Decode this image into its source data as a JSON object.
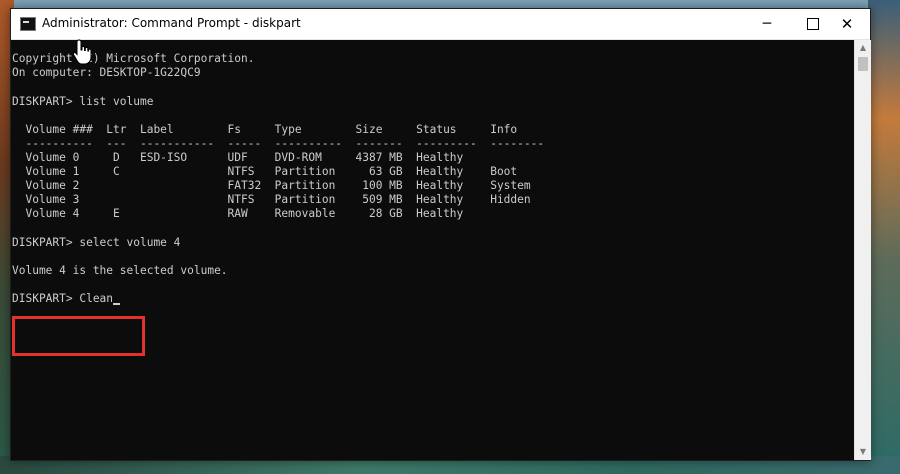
{
  "window": {
    "title": "Administrator: Command Prompt - diskpart",
    "controls": {
      "minimize": "─",
      "maximize": "",
      "close": "✕"
    }
  },
  "console": {
    "lines": [
      "Copyright (C) Microsoft Corporation.",
      "On computer: DESKTOP-1G22QC9",
      "",
      "DISKPART> list volume",
      "",
      "  Volume ###  Ltr  Label        Fs     Type        Size     Status     Info",
      "  ----------  ---  -----------  -----  ----------  -------  ---------  --------",
      "  Volume 0     D   ESD-ISO      UDF    DVD-ROM     4387 MB  Healthy",
      "  Volume 1     C                NTFS   Partition     63 GB  Healthy    Boot",
      "  Volume 2                      FAT32  Partition    100 MB  Healthy    System",
      "  Volume 3                      NTFS   Partition    509 MB  Healthy    Hidden",
      "  Volume 4     E                RAW    Removable     28 GB  Healthy",
      "",
      "DISKPART> select volume 4",
      "",
      "Volume 4 is the selected volume.",
      "",
      "DISKPART> Clean"
    ]
  },
  "scrollbar": {
    "up_arrow": "▲",
    "down_arrow": "▼"
  },
  "colors": {
    "console_bg": "#0c0c0c",
    "console_text": "#cccccc",
    "highlight": "#e1322e"
  },
  "icons": [
    "command-prompt-icon",
    "hand-pointer-icon",
    "scroll-up-icon",
    "scroll-down-icon"
  ]
}
